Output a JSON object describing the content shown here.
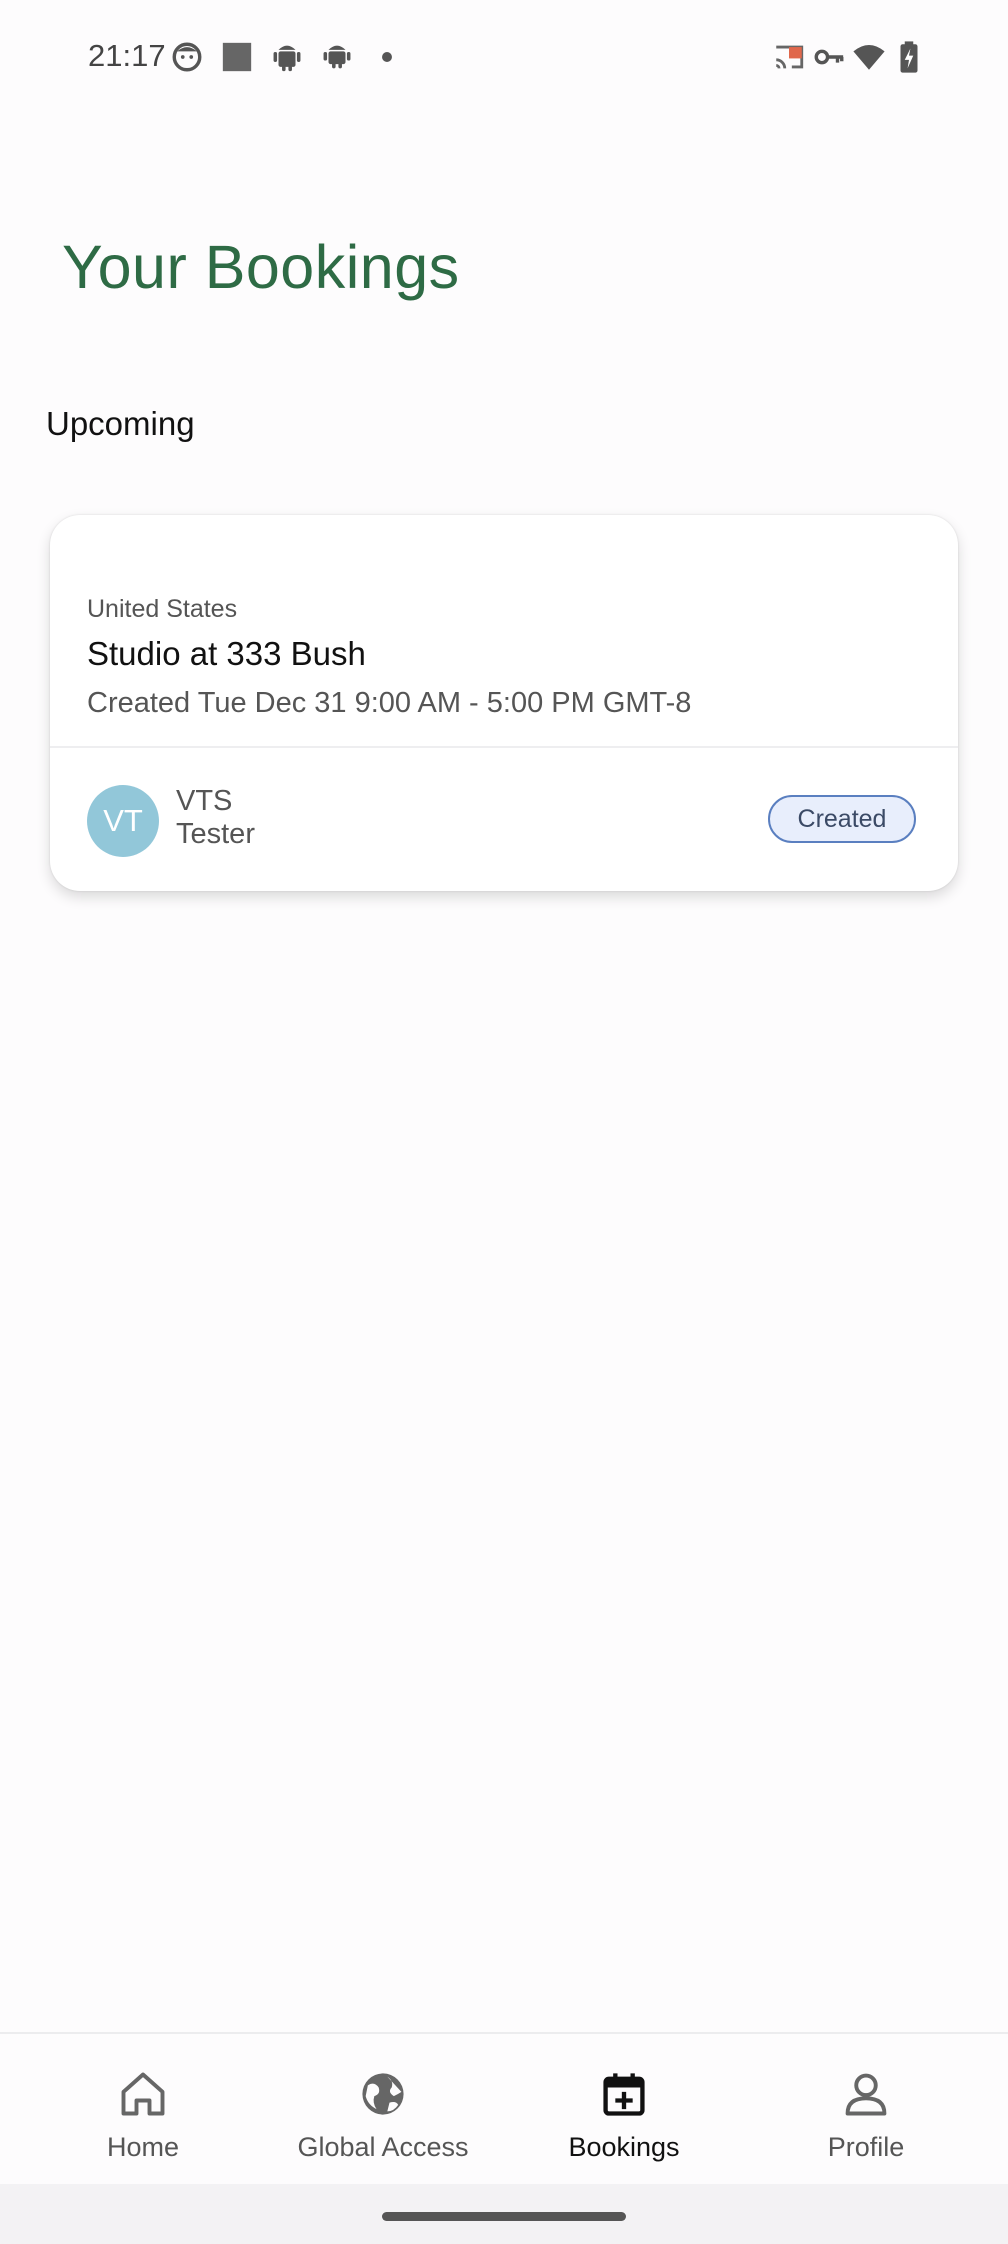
{
  "status_bar": {
    "time": "21:17",
    "left_icons": [
      "face-icon",
      "square-icon",
      "android-icon",
      "android-icon",
      "dot-icon"
    ],
    "right_icons": [
      "cast-icon",
      "vpn-key-icon",
      "wifi-icon",
      "battery-charging-icon"
    ]
  },
  "page": {
    "title": "Your Bookings",
    "section_heading": "Upcoming"
  },
  "booking": {
    "country": "United States",
    "venue": "Studio at 333 Bush",
    "details": "Created Tue Dec 31 9:00 AM - 5:00 PM GMT-8",
    "user_initials": "VT",
    "user_first": "VTS",
    "user_last": "Tester",
    "status": "Created"
  },
  "nav": {
    "items": [
      {
        "label": "Home",
        "icon": "home-icon"
      },
      {
        "label": "Global Access",
        "icon": "globe-icon"
      },
      {
        "label": "Bookings",
        "icon": "calendar-plus-icon"
      },
      {
        "label": "Profile",
        "icon": "person-icon"
      }
    ],
    "active": "Bookings"
  },
  "colors": {
    "title": "#2e6b45",
    "avatar": "#92c7d9",
    "badge_border": "#5a7fc0",
    "badge_fill": "#e8eefc"
  }
}
